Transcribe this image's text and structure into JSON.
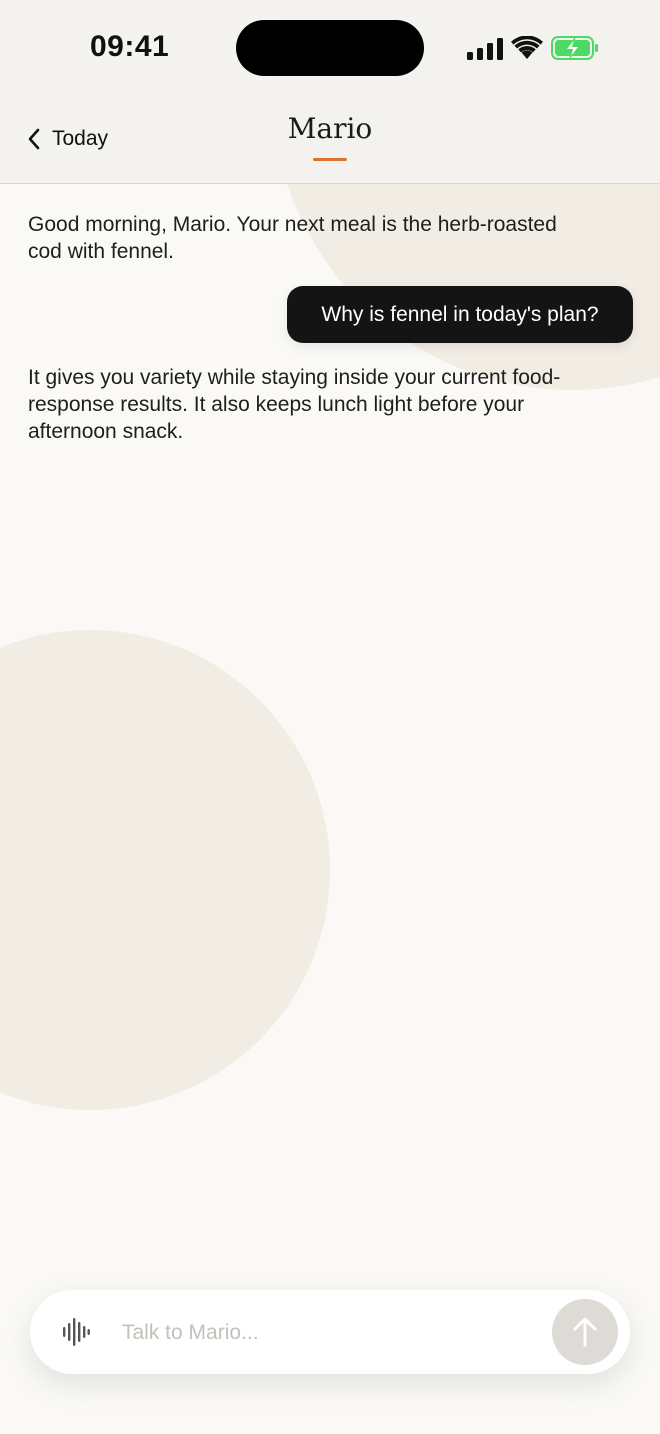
{
  "status_bar": {
    "time": "09:41"
  },
  "nav": {
    "back_label": "Today",
    "title": "Mario",
    "accent_color": "#e2712a"
  },
  "messages": [
    {
      "role": "assistant",
      "text": "Good morning, Mario. Your next meal is the herb-roasted cod with fennel."
    },
    {
      "role": "user",
      "text": "Why is fennel in today's plan?"
    },
    {
      "role": "assistant",
      "text": "It gives you variety while staying inside your current food-response results. It also keeps lunch light before your afternoon snack."
    }
  ],
  "composer": {
    "placeholder": "Talk to Mario...",
    "voice_icon": "waveform-icon",
    "send_icon": "arrow-up-icon"
  },
  "colors": {
    "background": "#faf9f6",
    "user_bubble": "#141414",
    "decor": "#f1ece4",
    "battery_charging": "#4cd964"
  }
}
